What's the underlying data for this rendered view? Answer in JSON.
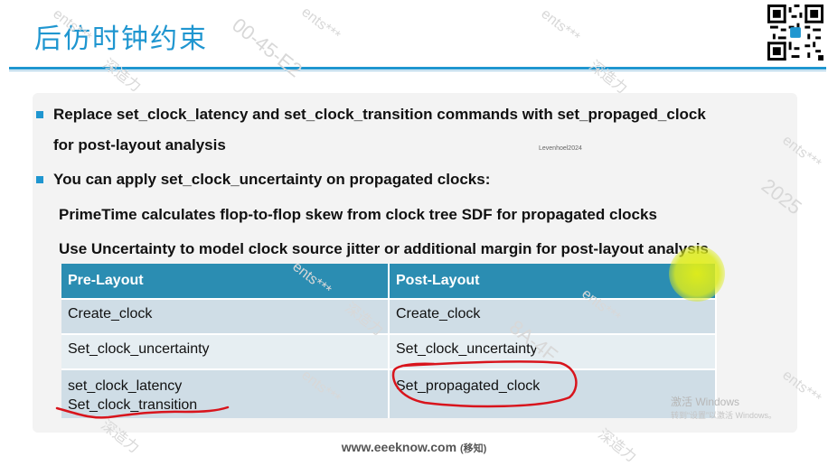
{
  "slide": {
    "title": "后仿时钟约束",
    "bullets": [
      {
        "text_line1": "Replace set_clock_latency and set_clock_transition commands with set_propaged_clock",
        "text_line2": "for post-layout analysis"
      },
      {
        "text_line1": "You can apply set_clock_uncertainty on propagated clocks:"
      }
    ],
    "sub_items": [
      "PrimeTime calculates flop-to-flop skew from clock tree SDF for propagated clocks",
      "Use Uncertainty to model clock source jitter or additional margin for post-layout analysis"
    ],
    "table": {
      "headers": [
        "Pre-Layout",
        "Post-Layout"
      ],
      "rows": [
        [
          "Create_clock",
          "Create_clock"
        ],
        [
          "Set_clock_uncertainty",
          "Set_clock_uncertainty"
        ],
        [
          [
            "set_clock_latency",
            "Set_clock_transition"
          ],
          [
            "Set_propagated_clock"
          ]
        ]
      ]
    },
    "small_label": "Levenhoel2024",
    "annotation_color": "#d8141c",
    "accent_color": "#1f96d0",
    "header_color": "#2b8db2"
  },
  "system_watermark": {
    "line1": "激活 Windows",
    "line2": "转到“设置”以激活 Windows。"
  },
  "footer": {
    "site": "www.eeeknow.com",
    "note": "(移知)"
  },
  "watermarks": [
    "ents***",
    "深造力",
    "2025",
    "00-45-E2",
    "8A-4F"
  ]
}
